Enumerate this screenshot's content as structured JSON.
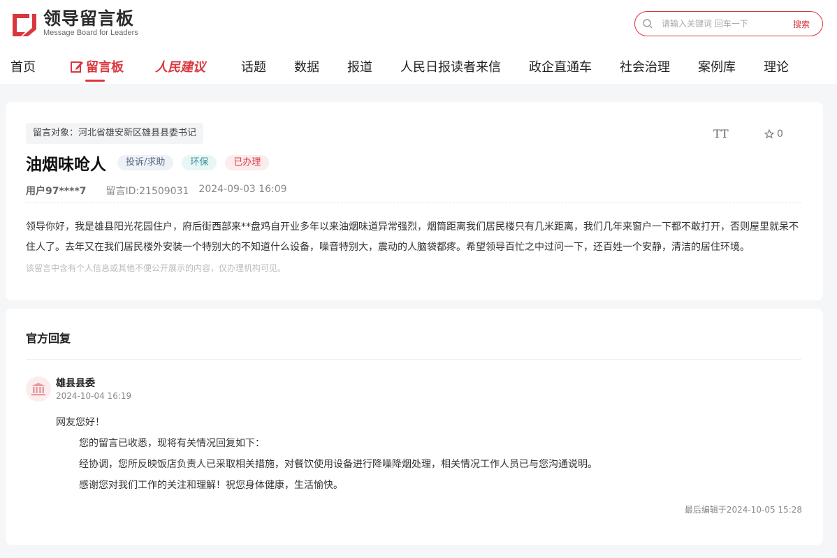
{
  "logo": {
    "cn": "领导留言板",
    "en": "Message Board for Leaders"
  },
  "search": {
    "placeholder": "请输入关键词 回车一下",
    "button": "搜索"
  },
  "nav": [
    {
      "label": "首页"
    },
    {
      "label": "留言板",
      "active": true
    },
    {
      "label": "人民建议"
    },
    {
      "label": "话题"
    },
    {
      "label": "数据"
    },
    {
      "label": "报道"
    },
    {
      "label": "人民日报读者来信"
    },
    {
      "label": "政企直通车"
    },
    {
      "label": "社会治理"
    },
    {
      "label": "案例库"
    },
    {
      "label": "理论"
    }
  ],
  "message": {
    "target": "留言对象：河北省雄安新区雄县县委书记",
    "title": "油烟味呛人",
    "tags": [
      "投诉/求助",
      "环保",
      "已办理"
    ],
    "user": "用户97****7",
    "id": "留言ID:21509031",
    "time": "2024-09-03 16:09",
    "star_count": "0",
    "font_toggle": "TT",
    "body": "领导你好，我是雄县阳光花园住户，府后街西部来**盘鸡自开业多年以来油烟味道异常强烈，烟筒距离我们居民楼只有几米距离，我们几年来窗户一下都不敢打开，否则屋里就呆不住人了。去年又在我们居民楼外安装一个特别大的不知道什么设备，噪音特别大，震动的人脑袋都疼。希望领导百忙之中过问一下，还百姓一个安静，清洁的居住环境。",
    "note": "该留言中含有个人信息或其他不便公开展示的内容，仅办理机构可见。"
  },
  "reply": {
    "section_title": "官方回复",
    "org": "雄县县委",
    "time": "2024-10-04 16:19",
    "greeting": "网友您好！",
    "lines": [
      "您的留言已收悉，现将有关情况回复如下：",
      "经协调，您所反映饭店负责人已采取相关措施，对餐饮使用设备进行降噪降烟处理，相关情况工作人员已与您沟通说明。",
      "感谢您对我们工作的关注和理解！祝您身体健康，生活愉快。"
    ],
    "edited": "最后编辑于2024-10-05 15:28"
  },
  "colors": {
    "accent": "#d9373e",
    "bg": "#f5f6f8"
  },
  "icons": {
    "logo": "logo-mark-icon",
    "search": "search-icon",
    "font": "font-size-icon",
    "star": "star-icon",
    "avatar": "government-building-icon",
    "edit": "edit-icon"
  }
}
